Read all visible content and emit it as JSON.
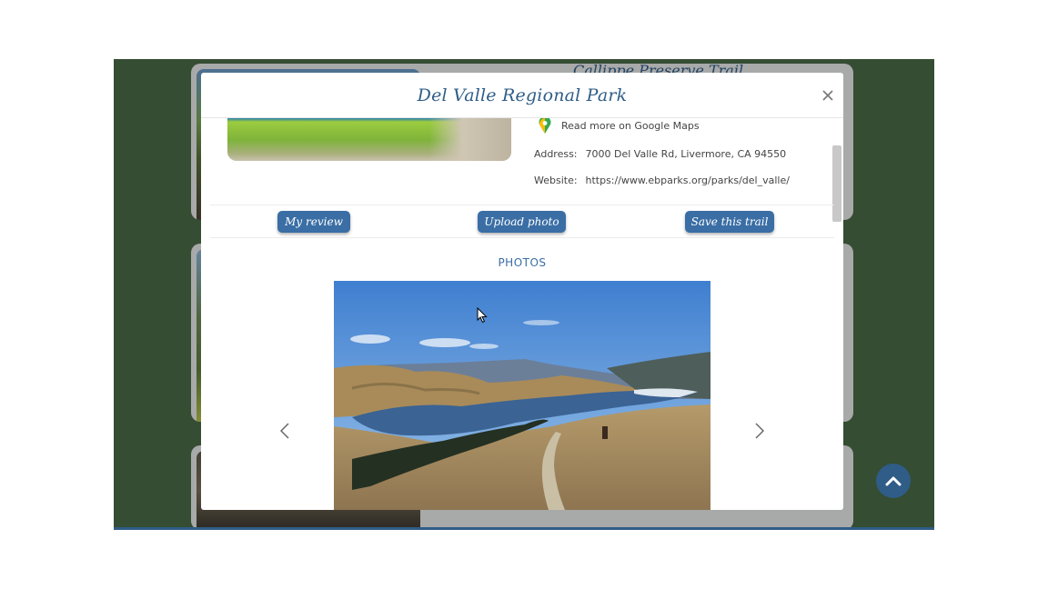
{
  "background": {
    "card_title": "Callippe Preserve Trail"
  },
  "modal": {
    "title": "Del Valle Regional Park",
    "maps_link": "Read more on Google Maps",
    "address_label": "Address:",
    "address_value": "7000 Del Valle Rd, Livermore, CA 94550",
    "website_label": "Website:",
    "website_value": "https://www.ebparks.org/parks/del_valle/",
    "buttons": {
      "my_review": "My review",
      "upload_photo": "Upload photo",
      "save_trail": "Save this trail"
    },
    "photos_heading": "PHOTOS"
  },
  "icons": {
    "close": "close-icon",
    "maps": "google-maps-pin-icon",
    "prev": "chevron-left-icon",
    "next": "chevron-right-icon",
    "scroll_top": "chevron-up-icon"
  },
  "colors": {
    "accent": "#3a6ea5",
    "title": "#2f5d87",
    "page_bg": "#4a6b47"
  }
}
